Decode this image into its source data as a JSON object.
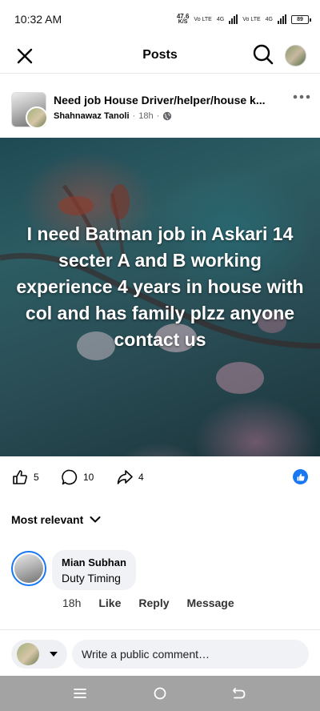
{
  "status_bar": {
    "time": "10:32 AM",
    "net_speed_value": "47.6",
    "net_speed_unit": "K/S",
    "sim1": "Vo LTE",
    "sim1_gen": "4G",
    "sim2": "Vo LTE",
    "sim2_gen": "4G",
    "battery": "89"
  },
  "header": {
    "title": "Posts"
  },
  "post": {
    "title": "Need job House Driver/helper/house k...",
    "author": "Shahnawaz Tanoli",
    "time": "18h",
    "image_text": "I need Batman job in Askari 14 secter A and B working experience 4 years in house with col and has family plzz anyone contact us",
    "likes": "5",
    "comments": "10",
    "shares": "4"
  },
  "comments_section": {
    "sort_label": "Most relevant",
    "items": [
      {
        "name": "Mian Subhan",
        "text": "Duty Timing",
        "time": "18h",
        "like_label": "Like",
        "reply_label": "Reply",
        "message_label": "Message"
      }
    ]
  },
  "composer": {
    "placeholder": "Write a public comment…"
  },
  "colors": {
    "accent": "#1877f2",
    "nav_bar": "#a3a3a3",
    "bubble": "#f0f2f5"
  }
}
